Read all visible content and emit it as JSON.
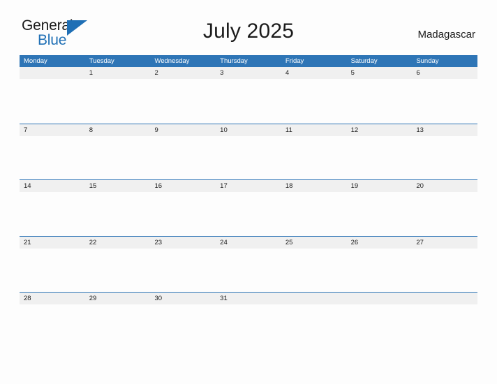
{
  "brand": {
    "name_top": "General",
    "name_bottom": "Blue",
    "triangle_icon": "triangle-icon",
    "color_primary": "#1f6fb5",
    "color_text": "#1b1b1b"
  },
  "header": {
    "title": "July 2025",
    "region": "Madagascar"
  },
  "calendar": {
    "month": "July",
    "year": "2025",
    "header_bg": "#2e75b6",
    "date_band_bg": "#f0f0f0",
    "weekdays": [
      "Monday",
      "Tuesday",
      "Wednesday",
      "Thursday",
      "Friday",
      "Saturday",
      "Sunday"
    ],
    "weeks": [
      {
        "days": [
          {
            "date": ""
          },
          {
            "date": "1"
          },
          {
            "date": "2"
          },
          {
            "date": "3"
          },
          {
            "date": "4"
          },
          {
            "date": "5"
          },
          {
            "date": "6"
          }
        ]
      },
      {
        "days": [
          {
            "date": "7"
          },
          {
            "date": "8"
          },
          {
            "date": "9"
          },
          {
            "date": "10"
          },
          {
            "date": "11"
          },
          {
            "date": "12"
          },
          {
            "date": "13"
          }
        ]
      },
      {
        "days": [
          {
            "date": "14"
          },
          {
            "date": "15"
          },
          {
            "date": "16"
          },
          {
            "date": "17"
          },
          {
            "date": "18"
          },
          {
            "date": "19"
          },
          {
            "date": "20"
          }
        ]
      },
      {
        "days": [
          {
            "date": "21"
          },
          {
            "date": "22"
          },
          {
            "date": "23"
          },
          {
            "date": "24"
          },
          {
            "date": "25"
          },
          {
            "date": "26"
          },
          {
            "date": "27"
          }
        ]
      },
      {
        "days": [
          {
            "date": "28"
          },
          {
            "date": "29"
          },
          {
            "date": "30"
          },
          {
            "date": "31"
          },
          {
            "date": ""
          },
          {
            "date": ""
          },
          {
            "date": ""
          }
        ]
      }
    ]
  }
}
